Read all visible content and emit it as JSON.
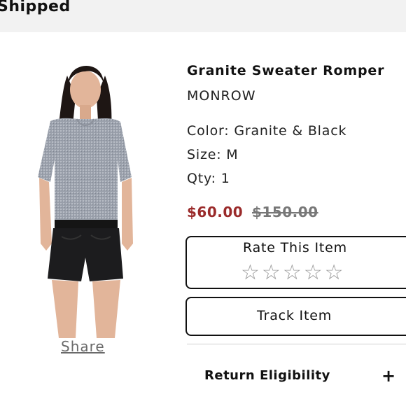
{
  "header": {
    "status": "Shipped"
  },
  "product": {
    "image_alt": "Model wearing grey sweater top and black shorts",
    "share_label": "Share",
    "title": "Granite Sweater Romper",
    "brand": "MONROW",
    "color": "Color: Granite & Black",
    "size": "Size: M",
    "qty": "Qty: 1",
    "sale_price": "$60.00",
    "original_price": "$150.00"
  },
  "rating": {
    "title": "Rate This Item",
    "stars": [
      "☆",
      "☆",
      "☆",
      "☆",
      "☆"
    ],
    "star_icon": "star-outline-icon"
  },
  "actions": {
    "track_label": "Track Item"
  },
  "return_eligibility": {
    "label": "Return Eligibility",
    "icon": "+"
  },
  "colors": {
    "sale_price": "#9a2a2a",
    "original_price": "#777777",
    "status_bar": "#f2f2f2"
  }
}
